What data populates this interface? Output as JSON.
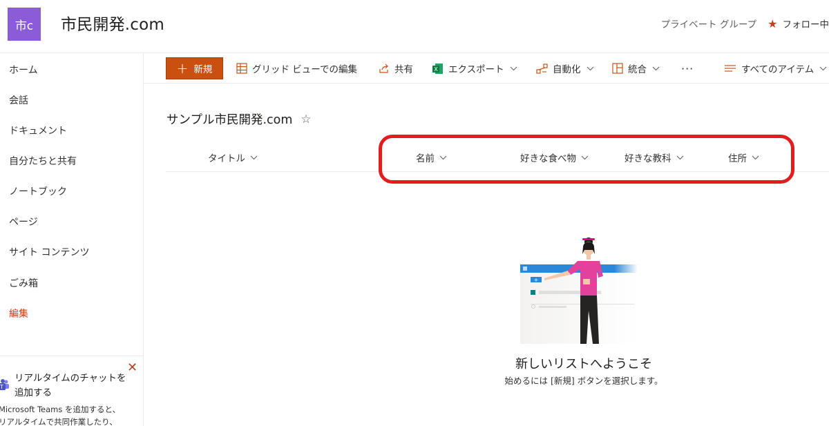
{
  "header": {
    "logo_text": "市c",
    "site_title": "市民開発.com",
    "group_type": "プライベート グループ",
    "follow_label": "フォロー中"
  },
  "nav": {
    "items": [
      "ホーム",
      "会話",
      "ドキュメント",
      "自分たちと共有",
      "ノートブック",
      "ページ",
      "サイト コンテンツ",
      "ごみ箱"
    ],
    "edit_label": "編集"
  },
  "teams_card": {
    "title": "リアルタイムのチャットを追加する",
    "description_line1": "Microsoft Teams を追加すると、",
    "description_line2": "リアルタイムで共同作業したり、"
  },
  "command_bar": {
    "new_label": "新規",
    "grid_edit_label": "グリッド ビューでの編集",
    "share_label": "共有",
    "export_label": "エクスポート",
    "automate_label": "自動化",
    "integrate_label": "統合",
    "more_label": "···",
    "view_label": "すべてのアイテム"
  },
  "list": {
    "title": "サンプル市民開発.com",
    "columns": [
      "タイトル",
      "名前",
      "好きな食べ物",
      "好きな教科",
      "住所"
    ]
  },
  "empty_state": {
    "title": "新しいリストへようこそ",
    "subtitle": "始めるには [新規] ボタンを選択します。"
  },
  "colors": {
    "accent": "#ca5010",
    "logo_bg": "#8a5cd8",
    "highlight": "#e01e1e"
  }
}
